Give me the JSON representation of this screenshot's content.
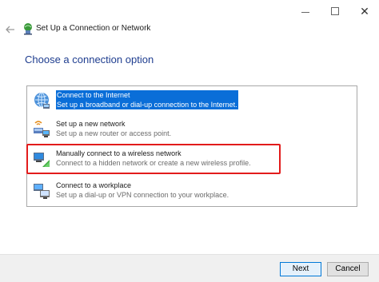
{
  "window": {
    "title": "Set Up a Connection or Network",
    "controls": [
      "minimize",
      "maximize",
      "close"
    ]
  },
  "heading": "Choose a connection option",
  "options": [
    {
      "title": "Connect to the Internet",
      "description": "Set up a broadband or dial-up connection to the Internet.",
      "icon": "globe-network-icon",
      "selected": true
    },
    {
      "title": "Set up a new network",
      "description": "Set up a new router or access point.",
      "icon": "router-icon",
      "selected": false
    },
    {
      "title": "Manually connect to a wireless network",
      "description": "Connect to a hidden network or create a new wireless profile.",
      "icon": "wireless-network-icon",
      "selected": false,
      "highlighted": true
    },
    {
      "title": "Connect to a workplace",
      "description": "Set up a dial-up or VPN connection to your workplace.",
      "icon": "workplace-vpn-icon",
      "selected": false
    }
  ],
  "buttons": {
    "next": "Next",
    "cancel": "Cancel"
  },
  "colors": {
    "heading": "#1e3d8f",
    "selection": "#0a6ed8",
    "highlight_border": "#e21b1b"
  }
}
